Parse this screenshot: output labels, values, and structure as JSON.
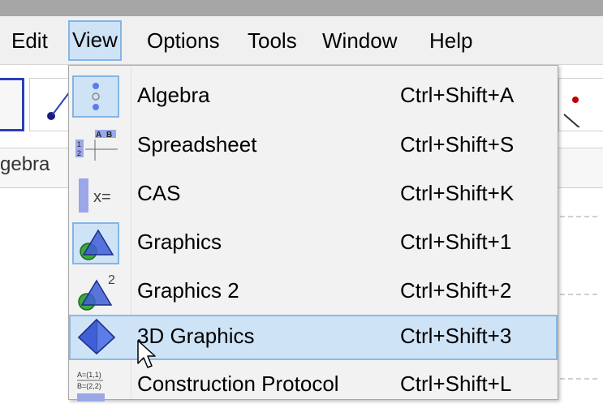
{
  "menubar": {
    "items": [
      {
        "label": "Edit"
      },
      {
        "label": "View"
      },
      {
        "label": "Options"
      },
      {
        "label": "Tools"
      },
      {
        "label": "Window"
      },
      {
        "label": "Help"
      }
    ],
    "active": "View"
  },
  "viewbar": {
    "label": "gebra"
  },
  "view_menu": {
    "items": [
      {
        "label": "Algebra",
        "shortcut": "Ctrl+Shift+A",
        "icon": "algebra-view-icon",
        "checked": true
      },
      {
        "label": "Spreadsheet",
        "shortcut": "Ctrl+Shift+S",
        "icon": "spreadsheet-view-icon",
        "checked": false
      },
      {
        "label": "CAS",
        "shortcut": "Ctrl+Shift+K",
        "icon": "cas-view-icon",
        "checked": false
      },
      {
        "label": "Graphics",
        "shortcut": "Ctrl+Shift+1",
        "icon": "graphics-view-icon",
        "checked": true
      },
      {
        "label": "Graphics 2",
        "shortcut": "Ctrl+Shift+2",
        "icon": "graphics-2-view-icon",
        "checked": false,
        "icon_text": "2"
      },
      {
        "label": "3D Graphics",
        "shortcut": "Ctrl+Shift+3",
        "icon": "3d-graphics-view-icon",
        "checked": false,
        "highlighted": true
      },
      {
        "label": "Construction Protocol",
        "shortcut": "Ctrl+Shift+L",
        "icon": "construction-protocol-icon",
        "checked": false,
        "icon_lines": [
          "A=(1,1)",
          "B=(2,2)"
        ]
      }
    ]
  },
  "spreadsheet_icon": {
    "cols": [
      "A",
      "B"
    ],
    "rows": [
      "1",
      "2"
    ]
  },
  "cas_icon": {
    "text": "x="
  },
  "colors": {
    "menu_highlight": "#cfe3f7",
    "menu_highlight_border": "#84b6e4",
    "menu_background": "#f2f2f2",
    "geometry_blue": "#3f5fd6",
    "geometry_green": "#3ea83e"
  }
}
